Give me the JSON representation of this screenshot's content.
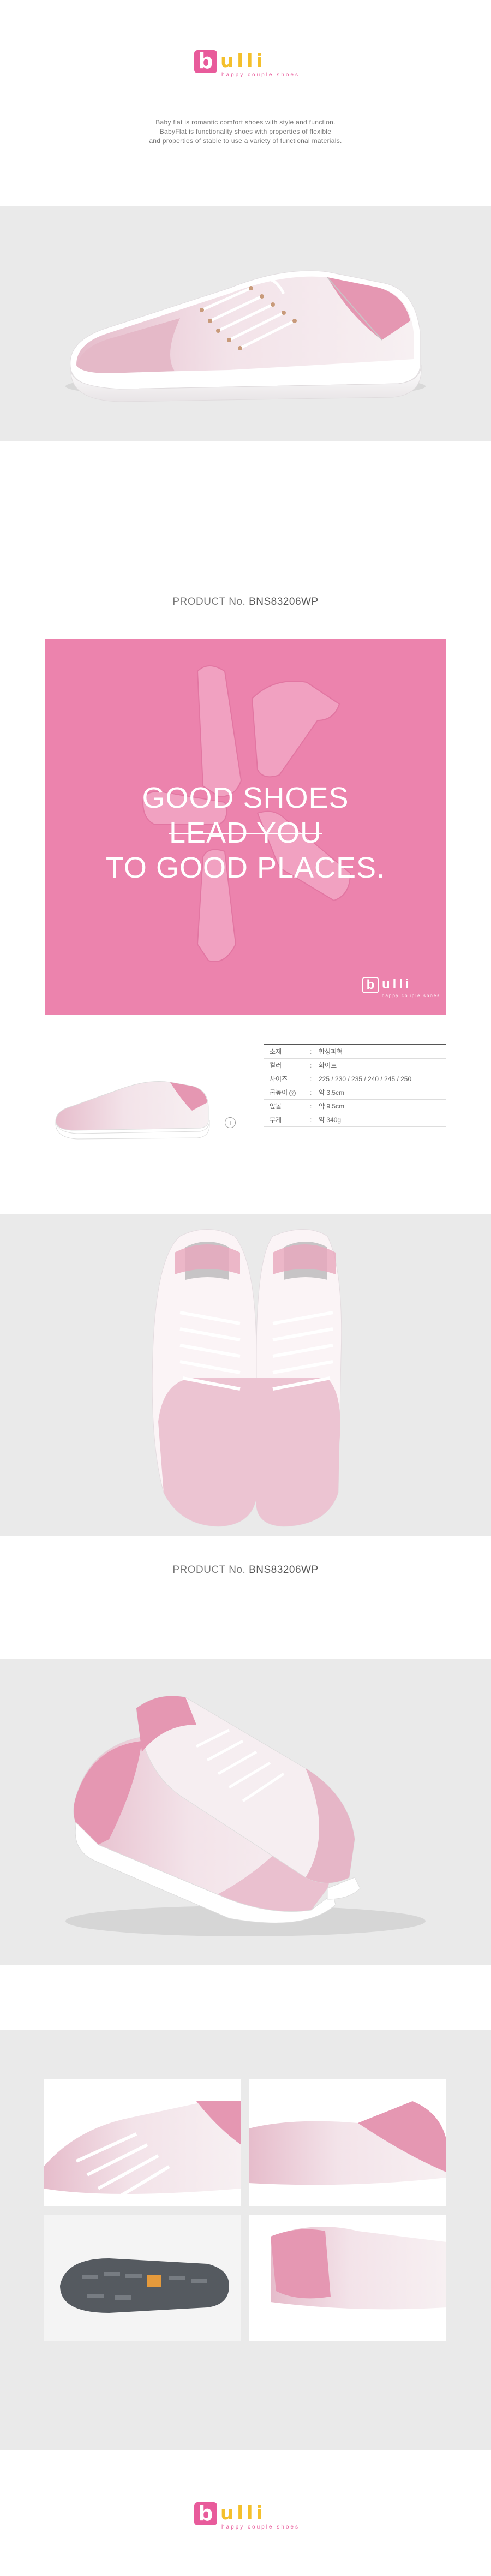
{
  "brand": {
    "letter": "b",
    "word": "ulli",
    "tagline": "happy couple shoes",
    "colors": {
      "pink": "#e85b9b",
      "yellow": "#f4c02c"
    }
  },
  "intro": {
    "lines": [
      "Baby flat is romantic comfort shoes with style and function.",
      "BabyFlat is functionality shoes with properties of flexible",
      "and properties of stable to use a variety of functional materials."
    ]
  },
  "product_label": {
    "prefix": "PRODUCT No.",
    "code": "BNS83206WP"
  },
  "banner": {
    "lines": [
      "GOOD SHOES",
      "LEAD YOU",
      "TO GOOD PLACES."
    ],
    "color": "#ec83ad"
  },
  "spec_icon": "+",
  "spec": [
    {
      "key": "소재",
      "value": "합성피혁"
    },
    {
      "key": "컬러",
      "value": "화이트"
    },
    {
      "key": "사이즈",
      "value": "225 / 230 / 235 / 240 / 245 / 250"
    },
    {
      "key": "굽높이",
      "value": "약 3.5cm",
      "help": "?"
    },
    {
      "key": "앞볼",
      "value": "약 9.5cm"
    },
    {
      "key": "무게",
      "value": "약 340g"
    }
  ]
}
